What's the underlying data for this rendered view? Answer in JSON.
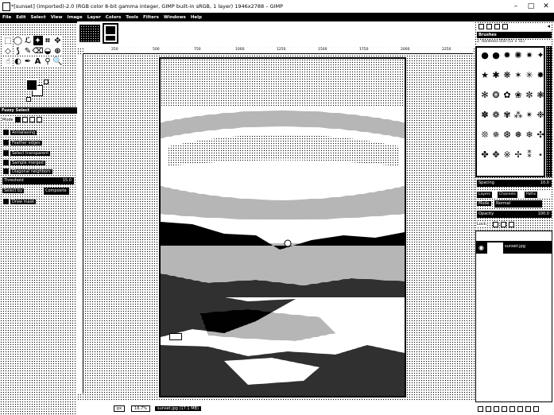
{
  "window": {
    "title": "*[sunset] (imported)-2.0 (RGB color 8-bit gamma integer, GIMP built-in sRGB, 1 layer) 1946x2788 – GIMP",
    "minimize": "–",
    "maximize": "□",
    "close": "✕"
  },
  "menu": [
    "File",
    "Edit",
    "Select",
    "View",
    "Image",
    "Layer",
    "Colors",
    "Tools",
    "Filters",
    "Windows",
    "Help"
  ],
  "toolbox": {
    "tools": [
      {
        "name": "rect-select-tool",
        "glyph": "⬚"
      },
      {
        "name": "ellipse-select-tool",
        "glyph": "◯"
      },
      {
        "name": "free-select-tool",
        "glyph": "ℒ"
      },
      {
        "name": "fuzzy-select-tool",
        "glyph": "✦"
      },
      {
        "name": "crop-tool",
        "glyph": "⌗"
      },
      {
        "name": "move-tool",
        "glyph": "✥"
      },
      {
        "name": "transform-tool",
        "glyph": "◇"
      },
      {
        "name": "warp-tool",
        "glyph": "⟆"
      },
      {
        "name": "paintbrush-tool",
        "glyph": "✎"
      },
      {
        "name": "eraser-tool",
        "glyph": "⌫"
      },
      {
        "name": "bucket-fill-tool",
        "glyph": "◒"
      },
      {
        "name": "clone-tool",
        "glyph": "⊕"
      },
      {
        "name": "smudge-tool",
        "glyph": "☝"
      },
      {
        "name": "dodge-burn-tool",
        "glyph": "◐"
      },
      {
        "name": "paths-tool",
        "glyph": "✒"
      },
      {
        "name": "text-tool",
        "glyph": "A"
      },
      {
        "name": "color-picker-tool",
        "glyph": "⚲"
      },
      {
        "name": "zoom-tool",
        "glyph": "🔍"
      }
    ],
    "options_header": "Fuzzy Select",
    "mode_label": "Mode",
    "options": [
      "Antialiasing",
      "Feather edges",
      "Select transparent",
      "Sample merged",
      "Diagonal neighbors"
    ],
    "threshold_label": "Threshold",
    "threshold_value": "15.0",
    "select_by_label": "Select by",
    "select_by_value": "Composite",
    "draw_mask_label": "Draw mask"
  },
  "canvas": {
    "ruler_ticks": [
      "250",
      "500",
      "750",
      "1000",
      "1250",
      "1500",
      "1750",
      "2000",
      "2250"
    ],
    "status_unit": "px",
    "status_zoom": "16.7%",
    "status_text": "sunset.jpg (17.1 MB)"
  },
  "dock": {
    "brushes_header": "Brushes",
    "brush_name": "2. Hardness 050 (51 × 51)",
    "spacing_label": "Spacing",
    "spacing_value": "10.0",
    "layers_tab": "Layers",
    "channels_tab": "Channels",
    "paths_tab": "Paths",
    "mode_label": "Mode",
    "mode_value": "Normal",
    "opacity_label": "Opacity",
    "opacity_value": "100.0",
    "lock_label": "Lock:",
    "layer_name": "sunset.jpg"
  },
  "colors": {
    "fg": "#000000",
    "bg": "#ffffff"
  }
}
